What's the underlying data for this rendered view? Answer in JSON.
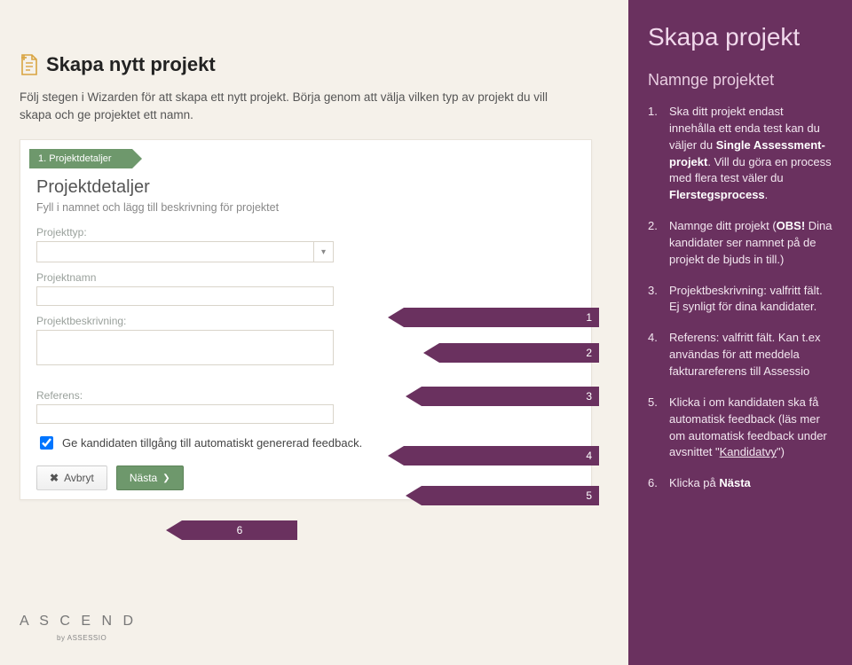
{
  "left": {
    "page_title": "Skapa nytt projekt",
    "intro": "Följ stegen i Wizarden för att skapa ett nytt projekt. Börja genom att välja vilken typ av projekt du vill skapa och ge projektet ett namn.",
    "wizard_step": "1. Projektdetaljer",
    "section_heading": "Projektdetaljer",
    "section_sub": "Fyll i namnet och lägg till beskrivning för projektet",
    "fields": {
      "type_label": "Projekttyp:",
      "name_label": "Projektnamn",
      "desc_label": "Projektbeskrivning:",
      "ref_label": "Referens:"
    },
    "checkbox_label": "Ge kandidaten tillgång till automatiskt genererad feedback.",
    "checkbox_checked": true,
    "buttons": {
      "cancel": "Avbryt",
      "next": "Nästa"
    }
  },
  "arrows": {
    "a1": "1",
    "a2": "2",
    "a3": "3",
    "a4": "4",
    "a5": "5",
    "a6": "6"
  },
  "right": {
    "title": "Skapa projekt",
    "subtitle": "Namnge projektet",
    "items": [
      {
        "num": "1.",
        "html": "Ska ditt projekt endast innehålla ett enda test kan du väljer du <span class='bold'>Single Assessment-projekt</span>. Vill du göra en process med flera test väler du <span class='bold'>Flerstegsprocess</span>."
      },
      {
        "num": "2.",
        "html": "Namnge ditt projekt (<span class='bold'>OBS!</span> Dina kandidater ser namnet på de projekt de bjuds in till.)"
      },
      {
        "num": "3.",
        "html": "Projektbeskrivning: valfritt fält. Ej synligt för dina kandidater."
      },
      {
        "num": "4.",
        "html": "Referens: valfritt fält. Kan t.ex användas för att meddela fakturareferens till Assessio"
      },
      {
        "num": "5.",
        "html": "Klicka i om kandidaten ska få automatisk feedback (läs mer om automatisk feedback under avsnittet \"<span class='linkish'>Kandidatvy</span>\")"
      },
      {
        "num": "6.",
        "html": "Klicka på <span class='bold'>Nästa</span>"
      }
    ]
  },
  "footer": {
    "logo": "A S C E N D",
    "sub": "by ASSESSIO"
  }
}
